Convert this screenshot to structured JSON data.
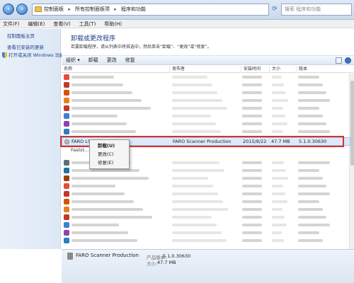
{
  "address": {
    "crumbs": [
      "控制面板",
      "所有控制面板项",
      "程序和功能"
    ],
    "search_placeholder": "搜索 程序和功能"
  },
  "menu": [
    "文件(F)",
    "编辑(E)",
    "查看(V)",
    "工具(T)",
    "帮助(H)"
  ],
  "left_panel": {
    "home": "控制面板主页",
    "updates": "查看已安装的更新",
    "features": "打开或关闭 Windows 功能"
  },
  "main": {
    "title": "卸载或更改程序",
    "subtitle": "若要卸载程序，请从列表中将其选中，然后单击“卸载”、“更改”或“修复”。"
  },
  "toolbar": [
    "组织 ▾",
    "卸载",
    "更改",
    "修复"
  ],
  "columns": [
    "名称",
    "发布者",
    "安装时间",
    "大小",
    "版本"
  ],
  "selected_row": {
    "name": "FARO LS",
    "publisher": "FARO Scanner Production",
    "installed": "2015/8/22",
    "size": "47.7 MB",
    "version": "5.1.0.30630"
  },
  "next_row_name": "Fastst...",
  "context_menu": [
    "卸载(U)",
    "更改(C)",
    "修复(E)"
  ],
  "details": {
    "publisher": "FARO Scanner Production",
    "version_label": "产品版本:",
    "version": "5.1.0.30630",
    "size_label": "大小:",
    "size": "47.7 MB"
  },
  "icon_colors": [
    "#e74c3c",
    "#c0392b",
    "#d35400",
    "#e67e22",
    "#c0392b",
    "#3b7fd4",
    "#8e44ad",
    "#2980b9",
    "#7f8c8d",
    "#95a5a6",
    "#16a085",
    "#5d6d7e",
    "#2471a3",
    "#a04000"
  ]
}
